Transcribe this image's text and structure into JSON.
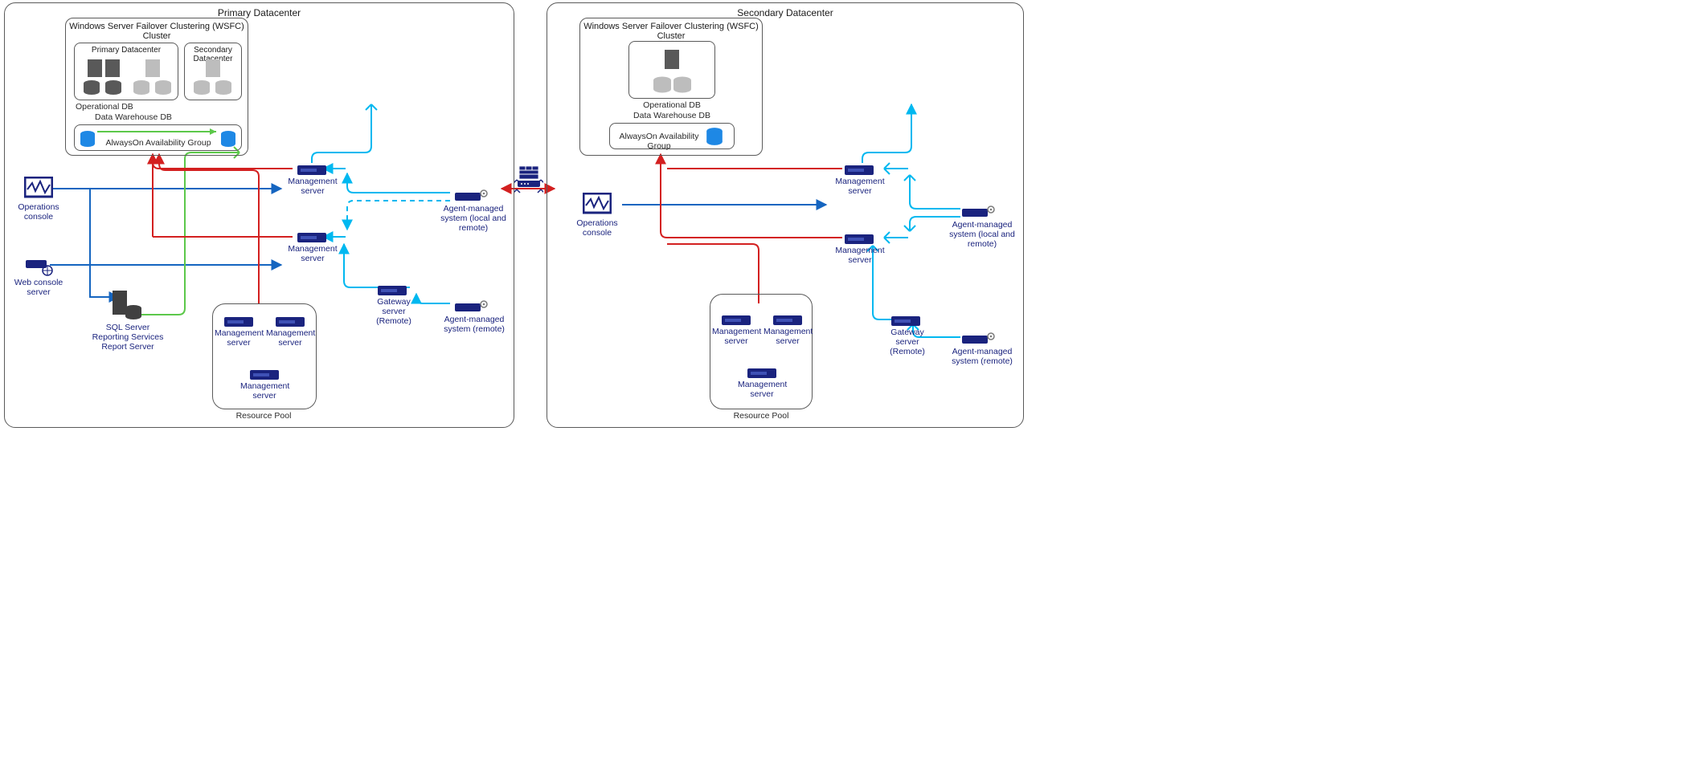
{
  "primary": {
    "title": "Primary Datacenter",
    "wsfc": "Windows Server Failover Clustering (WSFC) Cluster",
    "pd": "Primary Datacenter",
    "sd": "Secondary Datacenter",
    "opdb": "Operational DB",
    "dwdb": "Data Warehouse DB",
    "ag": "AlwaysOn Availability Group",
    "opconsole": "Operations console",
    "webconsole": "Web console server",
    "ssrs": "SQL Server\nReporting Services\nReport Server",
    "mgmt": "Management server",
    "gateway": "Gateway server (Remote)",
    "ams_local": "Agent-managed system (local and remote)",
    "ams_remote": "Agent-managed system (remote)",
    "resource_pool": "Resource Pool"
  },
  "secondary": {
    "title": "Secondary Datacenter",
    "wsfc": "Windows Server Failover Clustering (WSFC) Cluster",
    "opdb": "Operational DB",
    "dwdb": "Data Warehouse DB",
    "ag": "AlwaysOn Availability Group",
    "opconsole": "Operations console",
    "mgmt": "Management server",
    "gateway": "Gateway server (Remote)",
    "ams_local": "Agent-managed system (local and remote)",
    "ams_remote": "Agent-managed system (remote)",
    "resource_pool": "Resource Pool"
  },
  "colors": {
    "blue": "#1565c0",
    "cyan": "#00b8f0",
    "red": "#d32020",
    "green": "#5cc84a",
    "navy": "#1a237e",
    "grey": "#7a7a7a"
  }
}
